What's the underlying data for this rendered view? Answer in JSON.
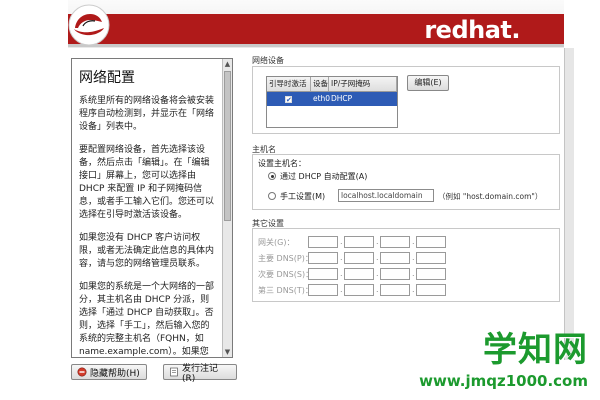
{
  "header": {
    "brand": "redhat",
    "brand_dot": "."
  },
  "help": {
    "title": "网络配置",
    "paragraphs": [
      "系统里所有的网络设备将会被安装程序自动检测到，并显示在「网络设备」列表中。",
      "要配置网络设备，首先选择该设备，然后点击「编辑」。在「编辑接口」屏幕上，您可以选择由 DHCP 来配置 IP 和子网掩码信息，或者手工输入它们。您还可以选择在引导时激活该设备。",
      "如果您没有 DHCP 客户访问权限，或者无法确定此信息的具体内容，请与您的网络管理员联系。",
      "如果您的系统是一个大网络的一部分，其主机名由 DHCP 分派，则选择「通过 DHCP 自动获取」。否则，选择「手工」，然后输入您的系统的完整主机名（FQHN，如 name.example.com）。如果您不输入，您的系统将会被识别"
    ]
  },
  "buttons": {
    "hide_help": "隐藏帮助(H)",
    "release_notes": "发行注记(R)",
    "edit": "编辑(E)"
  },
  "network_devices": {
    "section_title": "网络设备",
    "columns": [
      "引导时激活",
      "设备",
      "IP/子网掩码"
    ],
    "rows": [
      {
        "active": "✔",
        "device": "eth0",
        "ip": "DHCP"
      }
    ]
  },
  "hostname": {
    "section_title": "主机名",
    "set_label": "设置主机名：",
    "option_dhcp": "通过 DHCP 自动配置(A)",
    "option_manual": "手工设置(M)",
    "manual_value": "localhost.localdomain",
    "example_hint": "（例如 \"host.domain.com\"）"
  },
  "other": {
    "section_title": "其它设置",
    "gateway": "网关(G)：",
    "dns_primary": "主要 DNS(P)：",
    "dns_secondary": "次要 DNS(S)：",
    "dns_tertiary": "第三 DNS(T)："
  },
  "watermark": {
    "title": "学知网",
    "url": "www.jmqz1000.com"
  },
  "colors": {
    "brand_red": "#b01a1a",
    "selection_blue": "#2d5bb5",
    "watermark_green": "#1c9a2e"
  }
}
